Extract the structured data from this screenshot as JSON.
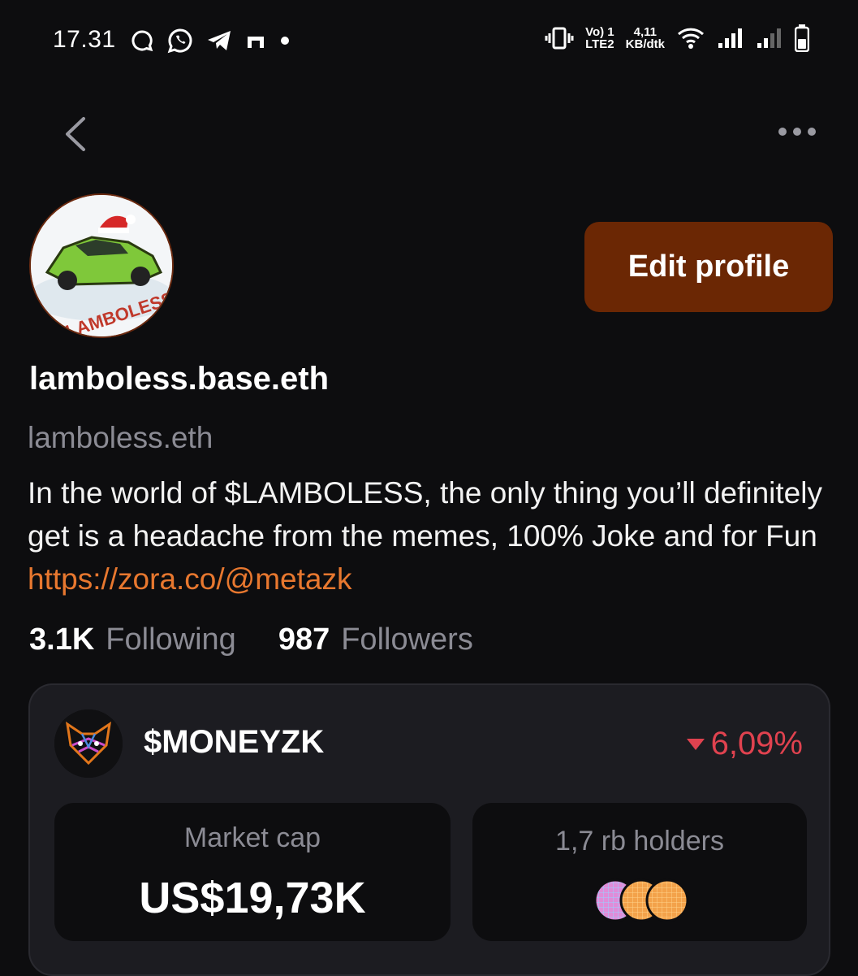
{
  "status_bar": {
    "time": "17.31",
    "network_top": "Vo) 1",
    "network_bottom": "LTE2",
    "speed_value": "4,11",
    "speed_unit": "KB/dtk"
  },
  "profile": {
    "display_name": "lamboless.base.eth",
    "handle": "lamboless.eth",
    "bio_text": "In the world of $LAMBOLESS, the only thing you’ll definitely get is a headache from the memes, 100% Joke and for Fun ",
    "bio_link": "https://zora.co/@metazk",
    "avatar_caption": "LAMBOLESS",
    "edit_button_label": "Edit profile",
    "following_count": "3.1K",
    "following_label": "Following",
    "followers_count": "987",
    "followers_label": "Followers"
  },
  "coin": {
    "name": "$MONEYZK",
    "change": "6,09%",
    "market_cap_label": "Market cap",
    "market_cap_value": "US$19,73K",
    "holders_label": "1,7 rb holders"
  },
  "colors": {
    "background": "#0d0d0f",
    "accent_button": "#6b2704",
    "link": "#e8782f",
    "negative": "#e0424f",
    "card": "#1c1c21"
  }
}
